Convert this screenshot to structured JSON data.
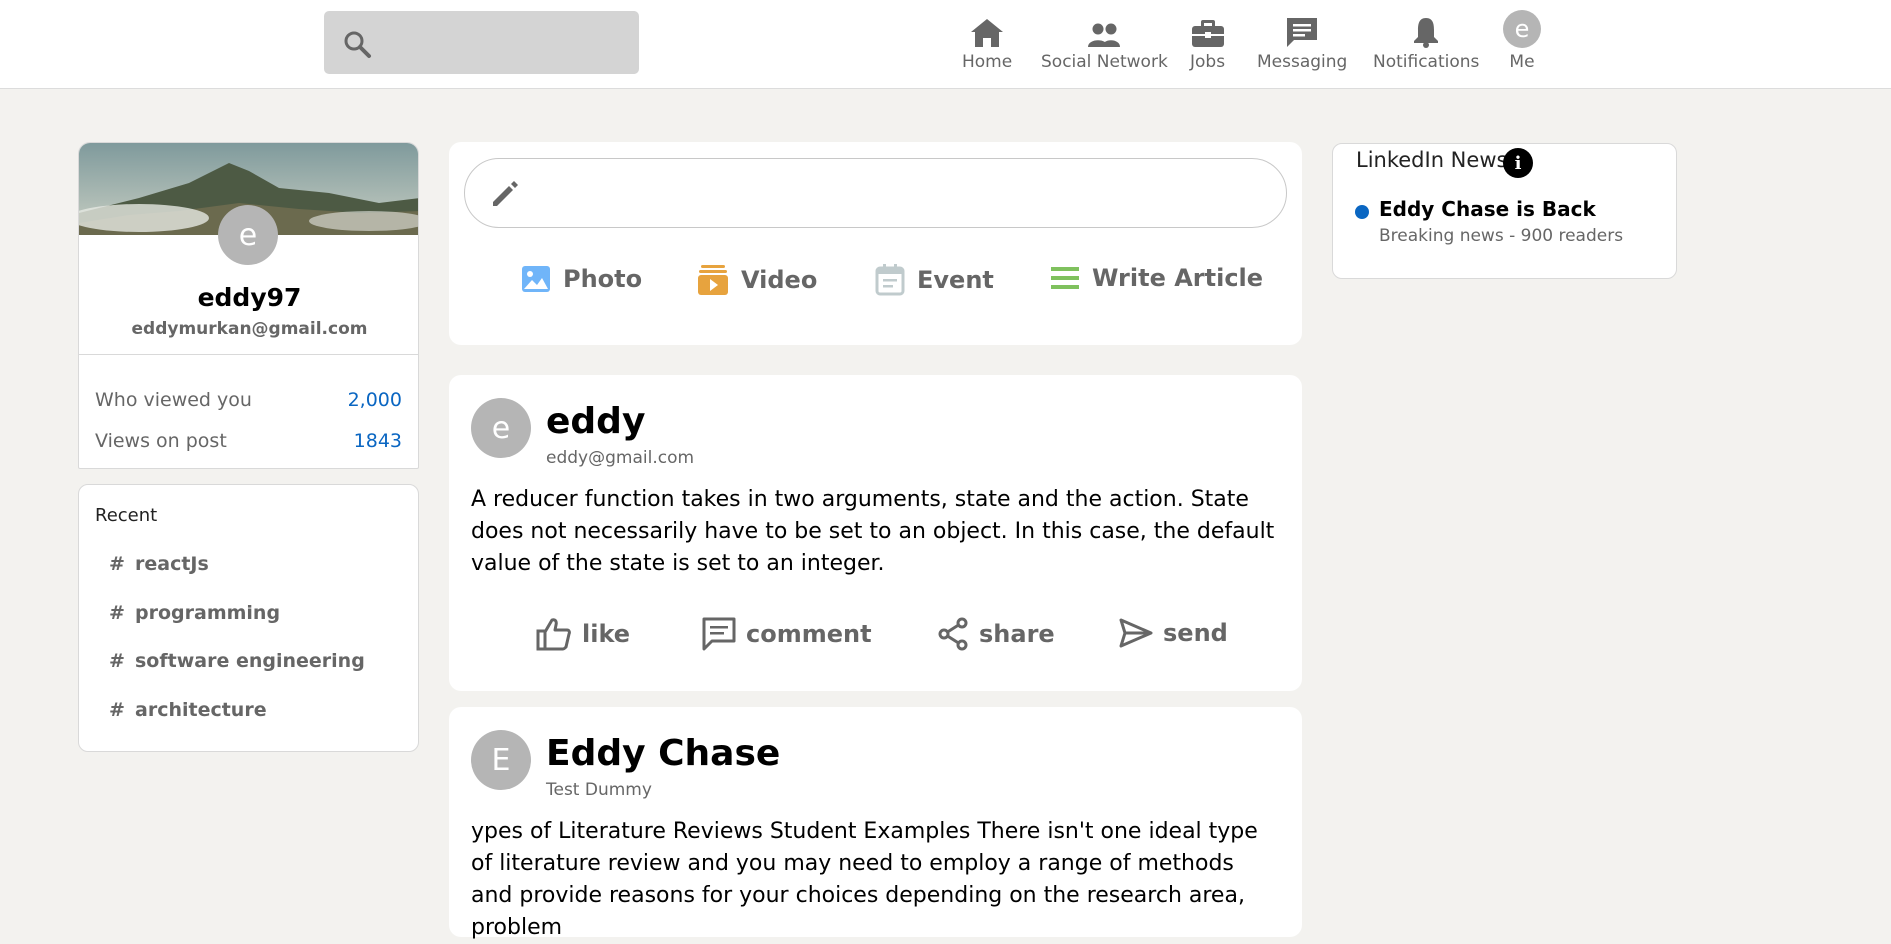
{
  "header": {
    "search_placeholder": "",
    "nav": [
      {
        "label": "Home",
        "icon": "home-icon"
      },
      {
        "label": "Social Network",
        "icon": "people-icon"
      },
      {
        "label": "Jobs",
        "icon": "briefcase-icon"
      },
      {
        "label": "Messaging",
        "icon": "chat-icon"
      },
      {
        "label": "Notifications",
        "icon": "bell-icon"
      },
      {
        "label": "Me",
        "icon": "avatar",
        "avatar_letter": "e"
      }
    ]
  },
  "profile": {
    "avatar_letter": "e",
    "username": "eddy97",
    "email": "eddymurkan@gmail.com"
  },
  "stats": [
    {
      "label": "Who viewed you",
      "value": "2,000"
    },
    {
      "label": "Views on post",
      "value": "1843"
    }
  ],
  "recent": {
    "title": "Recent",
    "items": [
      {
        "hash": "#",
        "label": "reactJs"
      },
      {
        "hash": "#",
        "label": "programming"
      },
      {
        "hash": "#",
        "label": "software engineering"
      },
      {
        "hash": "#",
        "label": "architecture"
      }
    ]
  },
  "share_box": {
    "input_value": "",
    "options": [
      {
        "label": "Photo",
        "icon": "photo-icon",
        "color": "#70b5f9"
      },
      {
        "label": "Video",
        "icon": "video-icon",
        "color": "#e7a33e"
      },
      {
        "label": "Event",
        "icon": "event-icon",
        "color": "#c0cbcd"
      },
      {
        "label": "Write Article",
        "icon": "article-icon",
        "color": "#7fc15e"
      }
    ]
  },
  "posts": [
    {
      "avatar_letter": "e",
      "author": "eddy",
      "subtitle": "eddy@gmail.com",
      "body": "A reducer function takes in two arguments, state and the action. State does not necessarily have to be set to an object. In this case, the default value of the state is set to an integer.",
      "actions": [
        "like",
        "comment",
        "share",
        "send"
      ]
    },
    {
      "avatar_letter": "E",
      "author": "Eddy Chase",
      "subtitle": "Test Dummy",
      "body": "ypes of Literature Reviews Student Examples There isn't one ideal type of literature review and you may need to employ a range of methods and provide reasons for your choices depending on the research area, problem"
    }
  ],
  "news": {
    "title": "LinkedIn News",
    "info_glyph": "i",
    "items": [
      {
        "headline": "Eddy Chase is Back",
        "meta": "Breaking news - 900 readers"
      }
    ]
  },
  "colors": {
    "accent": "#0a66c2",
    "page_bg": "#f3f2ef",
    "muted_text": "#666666"
  }
}
